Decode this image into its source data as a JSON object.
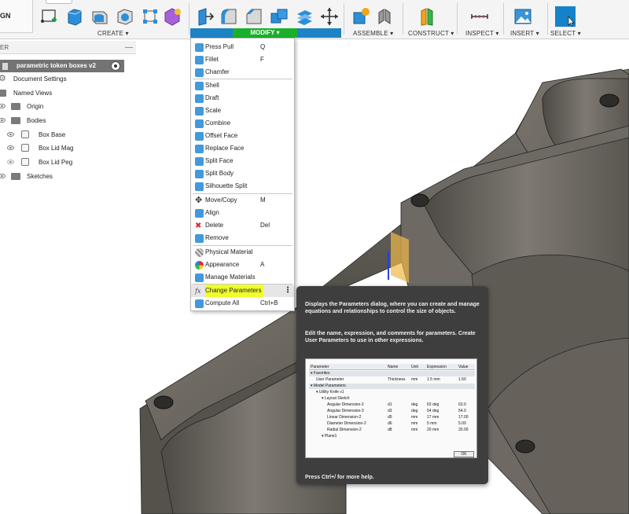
{
  "toolbar": {
    "design_label": "GN",
    "groups": {
      "create": "CREATE ▾",
      "modify": "MODIFY ▾",
      "assemble": "ASSEMBLE ▾",
      "construct": "CONSTRUCT ▾",
      "inspect": "INSPECT ▾",
      "insert": "INSERT ▾",
      "select": "SELECT ▾"
    }
  },
  "browser": {
    "header": "ER",
    "root": "parametric token boxes v2",
    "items": [
      {
        "label": "Document Settings"
      },
      {
        "label": "Named Views"
      },
      {
        "label": "Origin"
      },
      {
        "label": "Bodies"
      },
      {
        "label": "Box Base"
      },
      {
        "label": "Box Lid Mag"
      },
      {
        "label": "Box Lid Peg"
      },
      {
        "label": "Sketches"
      }
    ]
  },
  "menu": {
    "items": [
      {
        "label": "Press Pull",
        "shortcut": "Q",
        "icon": "press-pull-icon"
      },
      {
        "label": "Fillet",
        "shortcut": "F",
        "icon": "fillet-icon"
      },
      {
        "label": "Chamfer",
        "shortcut": "",
        "icon": "chamfer-icon"
      },
      {
        "label": "Shell",
        "shortcut": "",
        "icon": "shell-icon"
      },
      {
        "label": "Draft",
        "shortcut": "",
        "icon": "draft-icon"
      },
      {
        "label": "Scale",
        "shortcut": "",
        "icon": "scale-icon"
      },
      {
        "label": "Combine",
        "shortcut": "",
        "icon": "combine-icon"
      },
      {
        "label": "Offset Face",
        "shortcut": "",
        "icon": "offset-face-icon"
      },
      {
        "label": "Replace Face",
        "shortcut": "",
        "icon": "replace-face-icon"
      },
      {
        "label": "Split Face",
        "shortcut": "",
        "icon": "split-face-icon"
      },
      {
        "label": "Split Body",
        "shortcut": "",
        "icon": "split-body-icon"
      },
      {
        "label": "Silhouette Split",
        "shortcut": "",
        "icon": "silhouette-split-icon"
      },
      {
        "label": "Move/Copy",
        "shortcut": "M",
        "icon": "move-copy-icon"
      },
      {
        "label": "Align",
        "shortcut": "",
        "icon": "align-icon"
      },
      {
        "label": "Delete",
        "shortcut": "Del",
        "icon": "delete-icon"
      },
      {
        "label": "Remove",
        "shortcut": "",
        "icon": "remove-icon"
      },
      {
        "label": "Physical Material",
        "shortcut": "",
        "icon": "physical-material-icon"
      },
      {
        "label": "Appearance",
        "shortcut": "A",
        "icon": "appearance-icon"
      },
      {
        "label": "Manage Materials",
        "shortcut": "",
        "icon": "manage-materials-icon"
      },
      {
        "label": "Change Parameters",
        "shortcut": "",
        "icon": "fx-icon"
      },
      {
        "label": "Compute All",
        "shortcut": "Ctrl+B",
        "icon": "compute-all-icon"
      }
    ],
    "fx_glyph": "fx"
  },
  "tooltip": {
    "desc1": "Displays the Parameters dialog, where you can create and manage equations and relationships to control the size of objects.",
    "desc2": "Edit the name, expression, and comments for parameters. Create User Parameters to use in other expressions.",
    "help": "Press Ctrl+/ for more help.",
    "table": {
      "headers": [
        "Parameter",
        "Name",
        "Unit",
        "Expression",
        "Value"
      ],
      "rows": [
        {
          "label": "▾ Favorites",
          "name": "",
          "unit": "",
          "expr": "",
          "value": "",
          "group": true,
          "indent": 0
        },
        {
          "label": "User Parameter",
          "name": "Thickness",
          "unit": "mm",
          "expr": "1.5 mm",
          "value": "1.50",
          "group": false,
          "indent": 1
        },
        {
          "label": "▾ Model Parameters",
          "name": "",
          "unit": "",
          "expr": "",
          "value": "",
          "group": true,
          "indent": 0
        },
        {
          "label": "▾ Utility Knife v1",
          "name": "",
          "unit": "",
          "expr": "",
          "value": "",
          "group": false,
          "indent": 1
        },
        {
          "label": "▾ Layout Sketch",
          "name": "",
          "unit": "",
          "expr": "",
          "value": "",
          "group": false,
          "indent": 2
        },
        {
          "label": "Angular Dimension-2",
          "name": "d1",
          "unit": "deg",
          "expr": "63 deg",
          "value": "63.0",
          "group": false,
          "indent": 3
        },
        {
          "label": "Angular Dimension-3",
          "name": "d3",
          "unit": "deg",
          "expr": "54 deg",
          "value": "54.0",
          "group": false,
          "indent": 3
        },
        {
          "label": "Linear Dimension-2",
          "name": "d5",
          "unit": "mm",
          "expr": "17 mm",
          "value": "17.00",
          "group": false,
          "indent": 3
        },
        {
          "label": "Diameter Dimension-2",
          "name": "d6",
          "unit": "mm",
          "expr": "5 mm",
          "value": "5.00",
          "group": false,
          "indent": 3
        },
        {
          "label": "Radial Dimension-2",
          "name": "d8",
          "unit": "mm",
          "expr": "20 mm",
          "value": "20.00",
          "group": false,
          "indent": 3
        },
        {
          "label": "▾ Plane1",
          "name": "",
          "unit": "",
          "expr": "",
          "value": "",
          "group": false,
          "indent": 2
        }
      ],
      "ok": "OK"
    }
  },
  "colors": {
    "highlight": "#f0ff2a",
    "modify_bar": "#1c83c4",
    "modify_label": "#19b12b",
    "tooltip_bg": "#3e3e3e",
    "model": "#6b6760"
  }
}
